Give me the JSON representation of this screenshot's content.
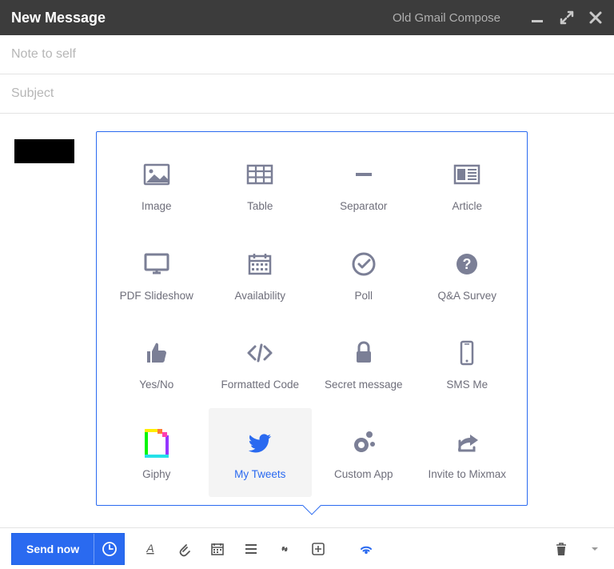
{
  "header": {
    "title": "New Message",
    "old_link": "Old Gmail Compose"
  },
  "fields": {
    "to_placeholder": "Note to self",
    "to_value": "",
    "subject_placeholder": "Subject",
    "subject_value": ""
  },
  "popover": {
    "tiles": [
      {
        "key": "image",
        "label": "Image"
      },
      {
        "key": "table",
        "label": "Table"
      },
      {
        "key": "separator",
        "label": "Separator"
      },
      {
        "key": "article",
        "label": "Article"
      },
      {
        "key": "pdf-slideshow",
        "label": "PDF Slideshow"
      },
      {
        "key": "availability",
        "label": "Availability"
      },
      {
        "key": "poll",
        "label": "Poll"
      },
      {
        "key": "qa-survey",
        "label": "Q&A Survey"
      },
      {
        "key": "yes-no",
        "label": "Yes/No"
      },
      {
        "key": "formatted-code",
        "label": "Formatted Code"
      },
      {
        "key": "secret-message",
        "label": "Secret message"
      },
      {
        "key": "sms-me",
        "label": "SMS Me"
      },
      {
        "key": "giphy",
        "label": "Giphy"
      },
      {
        "key": "my-tweets",
        "label": "My Tweets",
        "active": true
      },
      {
        "key": "custom-app",
        "label": "Custom App"
      },
      {
        "key": "invite-mixmax",
        "label": "Invite to Mixmax"
      }
    ]
  },
  "toolbar": {
    "send_label": "Send now"
  }
}
